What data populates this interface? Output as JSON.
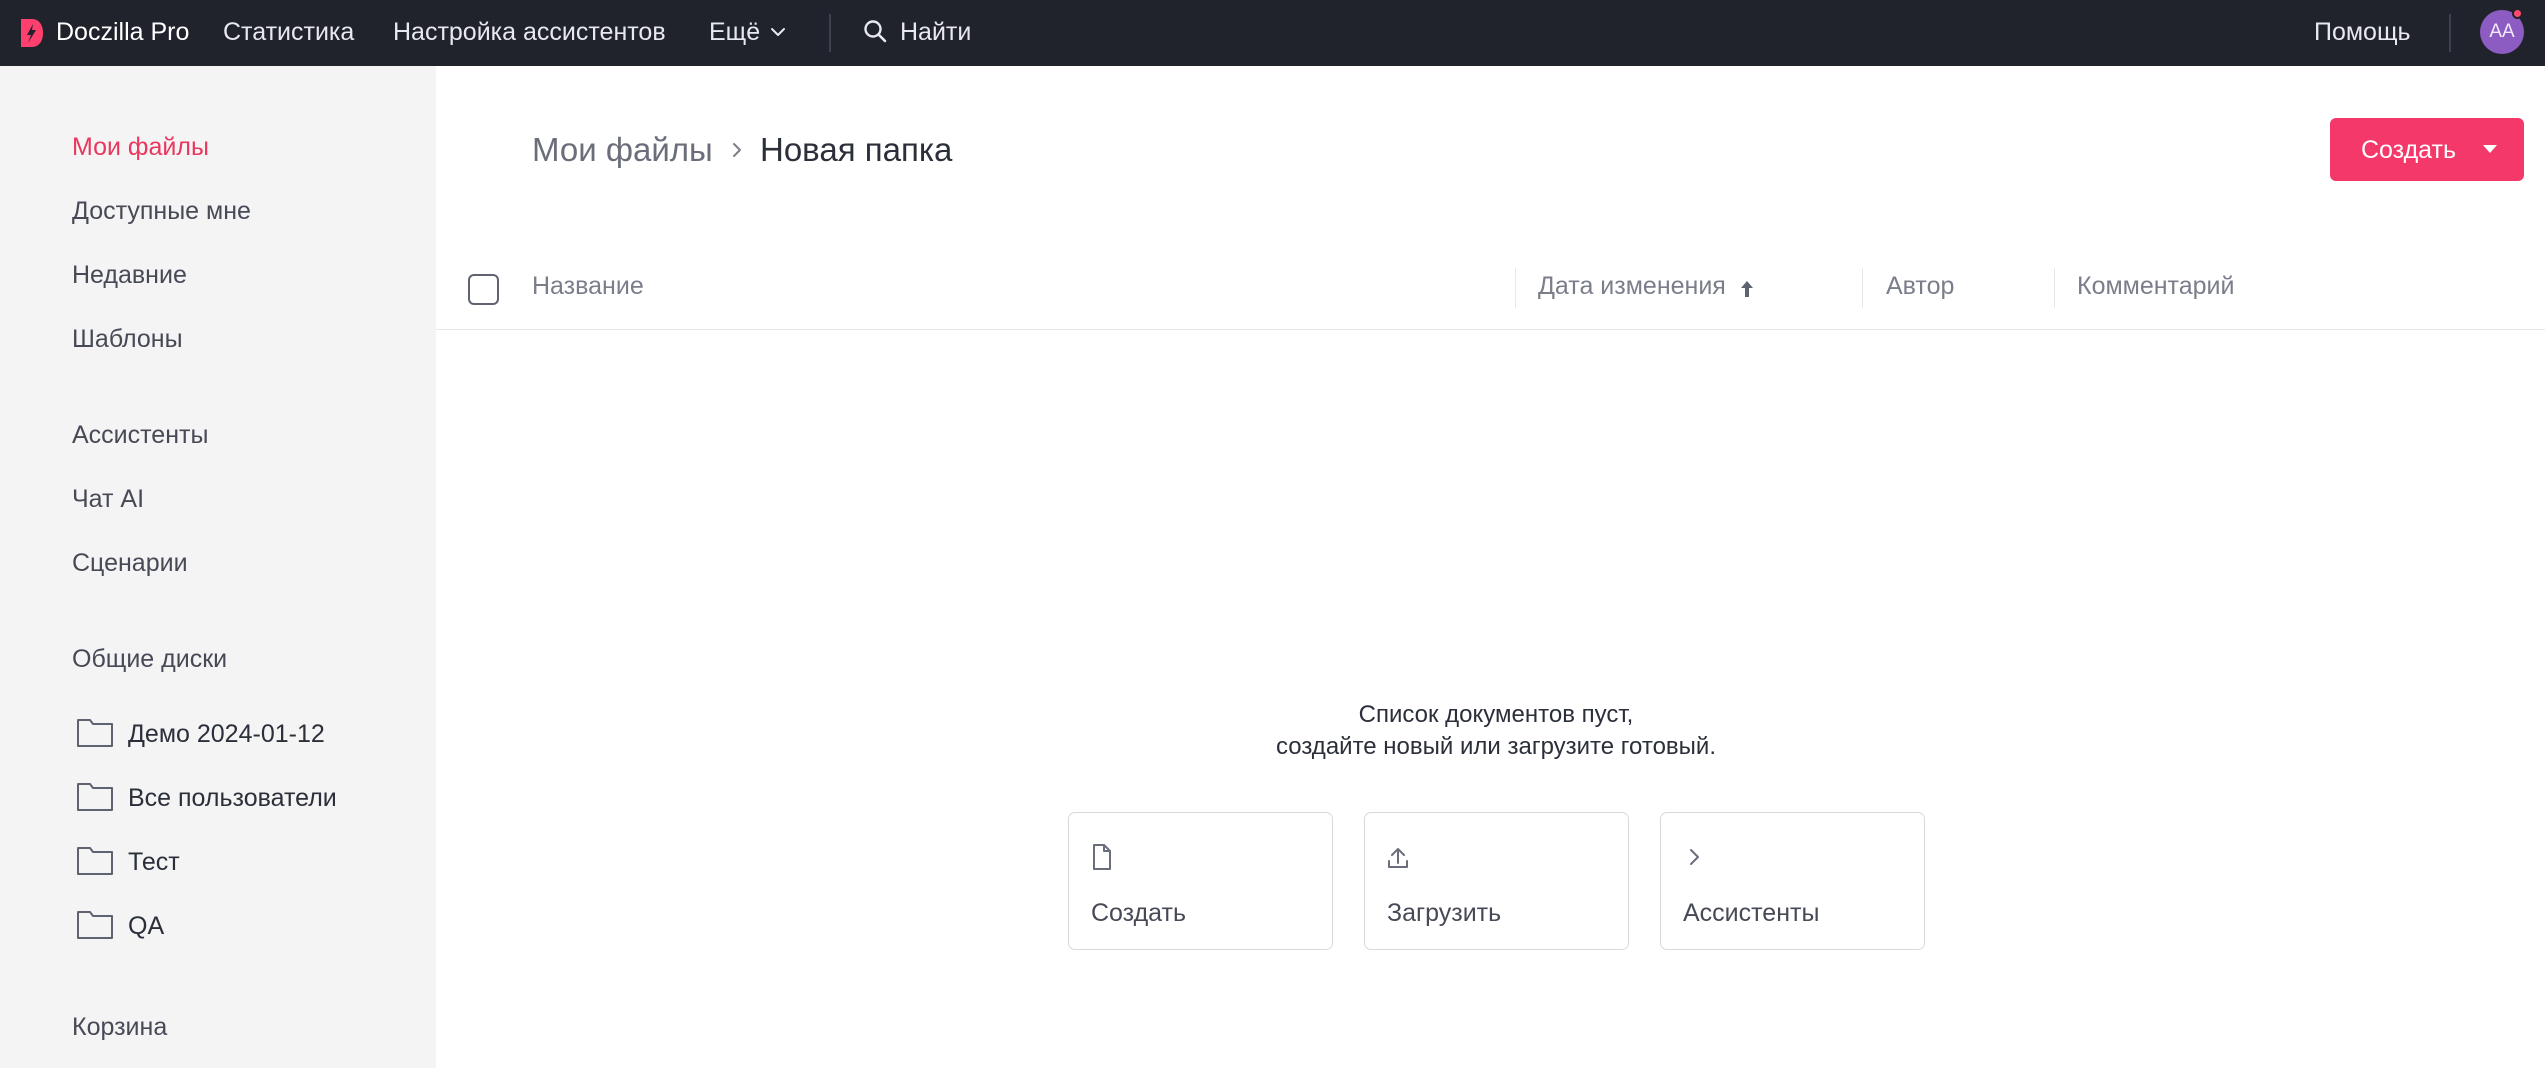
{
  "topbar": {
    "brand": "Doczilla Pro",
    "nav": [
      "Статистика",
      "Настройка ассистентов",
      "Ещё"
    ],
    "search_label": "Найти",
    "help_label": "Помощь",
    "avatar_initials": "AA"
  },
  "sidebar": {
    "primary": [
      "Мои файлы",
      "Доступные мне",
      "Недавние",
      "Шаблоны"
    ],
    "tools": [
      "Ассистенты",
      "Чат AI",
      "Сценарии"
    ],
    "shared_heading": "Общие диски",
    "shared_drives": [
      "Демо 2024-01-12",
      "Все пользователи",
      "Тест",
      "QA"
    ],
    "trash": "Корзина"
  },
  "main": {
    "breadcrumb_root": "Мои файлы",
    "breadcrumb_current": "Новая папка",
    "create_button": "Создать",
    "columns": [
      "Название",
      "Дата изменения",
      "Автор",
      "Комментарий"
    ],
    "empty_line1": "Список документов пуст,",
    "empty_line2": "создайте новый или загрузите готовый.",
    "actions": [
      "Создать",
      "Загрузить",
      "Ассистенты"
    ]
  },
  "colors": {
    "accent": "#f5386a",
    "topbar_bg": "#20222c",
    "sidebar_bg": "#f4f4f5",
    "active_link": "#e9375f",
    "avatar_bg": "#8d5cc2"
  }
}
